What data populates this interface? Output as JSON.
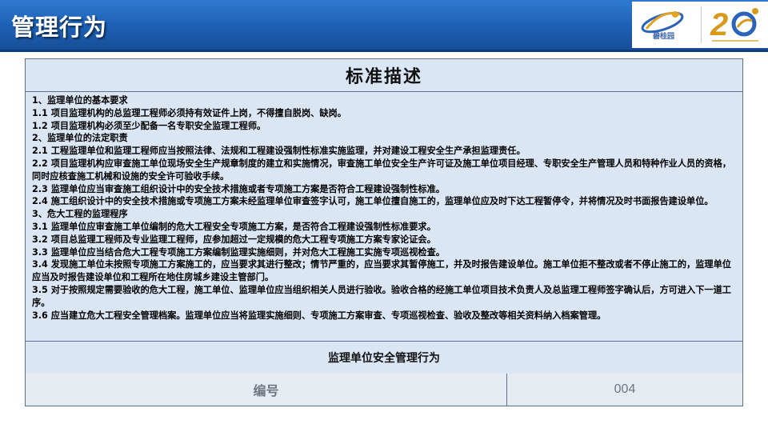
{
  "header": {
    "title": "管理行为",
    "brand_name": "碧桂园"
  },
  "table": {
    "heading": "标准描述",
    "lines": [
      "1、监理单位的基本要求",
      "1.1 项目监理机构的总监理工程师必须持有效证件上岗，不得擅自脱岗、缺岗。",
      "1.2 项目监理机构必须至少配备一名专职安全监理工程师。",
      "2、监理单位的法定职责",
      "2.1 工程监理单位和监理工程师应当按照法律、法规和工程建设强制性标准实施监理，并对建设工程安全生产承担监理责任。",
      "2.2 项目监理机构应审查施工单位现场安全生产规章制度的建立和实施情况，审查施工单位安全生产许可证及施工单位项目经理、专职安全生产管理人员和特种作业人员的资格，同时应核查施工机械和设施的安全许可验收手续。",
      "2.3 监理单位应当审查施工组织设计中的安全技术措施或者专项施工方案是否符合工程建设强制性标准。",
      "2.4 施工组织设计中的安全技术措施或专项施工方案未经监理单位审查签字认可，施工单位擅自施工的，监理单位应及时下达工程暂停令，并将情况及时书面报告建设单位。",
      "3、危大工程的监理程序",
      "3.1 监理单位应审查施工单位编制的危大工程安全专项施工方案，是否符合工程建设强制性标准要求。",
      "3.2 项目总监理工程师及专业监理工程师，应参加超过一定规模的危大工程专项施工方案专家论证会。",
      "3.3 监理单位应当结合危大工程专项施工方案编制监理实施细则，并对危大工程施工实施专项巡视检查。",
      "3.4 发现施工单位未按照专项施工方案施工的，应当要求其进行整改；情节严重的，应当要求其暂停施工，并及时报告建设单位。施工单位拒不整改或者不停止施工的，监理单位应当及时报告建设单位和工程所在地住房城乡建设主管部门。",
      "3.5 对于按照规定需要验收的危大工程，施工单位、监理单位应当组织相关人员进行验收。验收合格的经施工单位项目技术负责人及总监理工程师签字确认后，方可进入下一道工序。",
      "3.6 应当建立危大工程安全管理档案。监理单位应当将监理实施细则、专项施工方案审查、专项巡视检查、验收及整改等相关资料纳入档案管理。"
    ],
    "subtitle": "监理单位安全管理行为",
    "code_label": "编号",
    "code_value": "004"
  },
  "colors": {
    "header_blue": "#1c5fb4",
    "panel_fill": "#dbe6f5",
    "code_row_fill": "#e6ebf2",
    "anniversary_gold": "#d99a1c"
  }
}
